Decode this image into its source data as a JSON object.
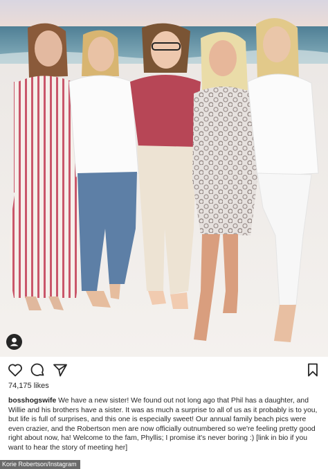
{
  "post": {
    "username": "bosshogswife",
    "caption_text": "We have a new sister! We found out not long ago that Phil has a daughter, and Willie and his brothers have a sister. It was as much a surprise to all of us as it probably is to you, but life is full of surprises, and this one is especially sweet! Our annual family beach pics were even crazier, and the Robertson men are now officially outnumbered so we're feeling pretty good right about now, ha! Welcome to the fam, Phyllis; I promise it's never boring :) [link in bio if you want to hear the story of meeting her]",
    "likes": "74,175 likes"
  },
  "icons": {
    "like": "heart-icon",
    "comment": "comment-icon",
    "share": "send-icon",
    "save": "bookmark-icon",
    "tag": "person-tag-icon"
  },
  "photo_credit": "Korie Robertson/Instagram"
}
